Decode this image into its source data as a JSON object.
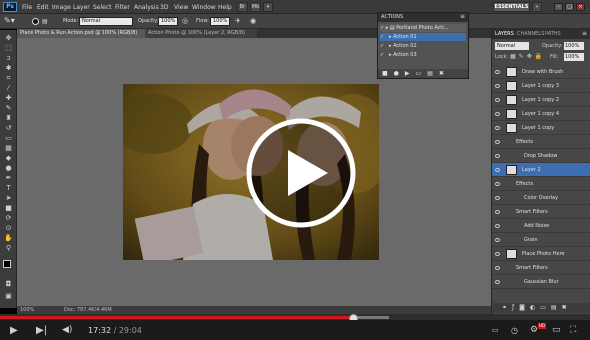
{
  "menubar": {
    "logo": "Ps",
    "items": [
      "File",
      "Edit",
      "Image",
      "Layer",
      "Select",
      "Filter",
      "Analysis",
      "3D",
      "View",
      "Window",
      "Help"
    ],
    "workspace_button": "ESSENTIALS",
    "cs_live": "CS Live"
  },
  "options": {
    "mode_label": "Mode:",
    "mode_value": "Normal",
    "opacity_label": "Opacity:",
    "opacity_value": "100%",
    "flow_label": "Flow:",
    "flow_value": "100%"
  },
  "document": {
    "tabs": [
      "Place Photo & Run Action.psd @ 100% (RGB/8)",
      "Action Photo @ 100% (Layer 2, RGB/8)"
    ],
    "status_zoom": "100%",
    "status_doc": "Doc: 787.4K/4.46M"
  },
  "actions_panel": {
    "title": "ACTIONS",
    "set_name": "Portland Photo Acti...",
    "items": [
      "Action 01",
      "Action 02",
      "Action 03"
    ]
  },
  "layers_panel": {
    "tabs": [
      "LAYERS",
      "CHANNELS",
      "PATHS"
    ],
    "blend_mode": "Normal",
    "opacity_label": "Opacity:",
    "opacity_value": "100%",
    "lock_label": "Lock:",
    "fill_label": "Fill:",
    "fill_value": "100%",
    "rows": [
      {
        "label": "Draw with Brush",
        "indent": 0
      },
      {
        "label": "Layer 1 copy 3",
        "indent": 0
      },
      {
        "label": "Layer 1 copy 2",
        "indent": 0
      },
      {
        "label": "Layer 1 copy 4",
        "indent": 0
      },
      {
        "label": "Layer 1 copy",
        "indent": 0
      },
      {
        "label": "Effects",
        "indent": 1
      },
      {
        "label": "Drop Shadow",
        "indent": 2
      },
      {
        "label": "Layer 2",
        "indent": 0
      },
      {
        "label": "Effects",
        "indent": 1
      },
      {
        "label": "Color Overlay",
        "indent": 2
      },
      {
        "label": "Smart Filters",
        "indent": 1
      },
      {
        "label": "Add Noise",
        "indent": 2
      },
      {
        "label": "Grain",
        "indent": 2
      },
      {
        "label": "Place Photo Here",
        "indent": 0
      },
      {
        "label": "Smart Filters",
        "indent": 1
      },
      {
        "label": "Gaussian Blur",
        "indent": 2
      }
    ]
  },
  "player": {
    "current_time": "17:32",
    "duration": "29:04",
    "time_separator": " / ",
    "played_fraction": 0.6,
    "hd_badge": "HD",
    "accent_color": "#cc181e"
  }
}
